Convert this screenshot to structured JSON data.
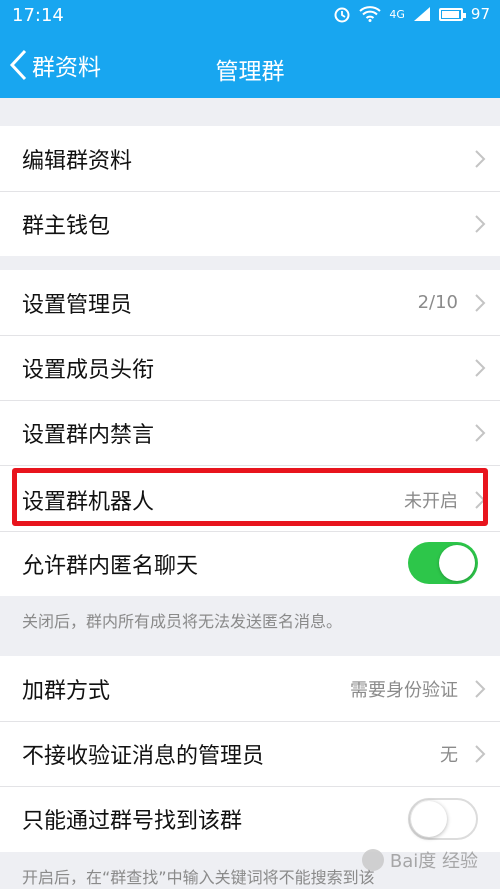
{
  "status_bar": {
    "time": "17:14",
    "network": "4G",
    "battery": "97"
  },
  "nav": {
    "back_label": "群资料",
    "title": "管理群"
  },
  "rows": {
    "edit_info": {
      "label": "编辑群资料"
    },
    "wallet": {
      "label": "群主钱包"
    },
    "admins": {
      "label": "设置管理员",
      "value": "2/10"
    },
    "member_titles": {
      "label": "设置成员头衔"
    },
    "mute": {
      "label": "设置群内禁言"
    },
    "robot": {
      "label": "设置群机器人",
      "value": "未开启"
    },
    "anonymous": {
      "label": "允许群内匿名聊天",
      "toggle": true
    },
    "join_method": {
      "label": "加群方式",
      "value": "需要身份验证"
    },
    "no_verify_admins": {
      "label": "不接收验证消息的管理员",
      "value": "无"
    },
    "find_by_number": {
      "label": "只能通过群号找到该群",
      "toggle": false
    }
  },
  "notes": {
    "anonymous_note": "关闭后，群内所有成员将无法发送匿名消息。",
    "find_note": "开启后，在“群查找”中输入关键词将不能搜索到该"
  },
  "watermark": "Bai度 经验",
  "colors": {
    "header": "#18a6f0",
    "toggle_on": "#2dc64a",
    "highlight": "#e8141d"
  }
}
